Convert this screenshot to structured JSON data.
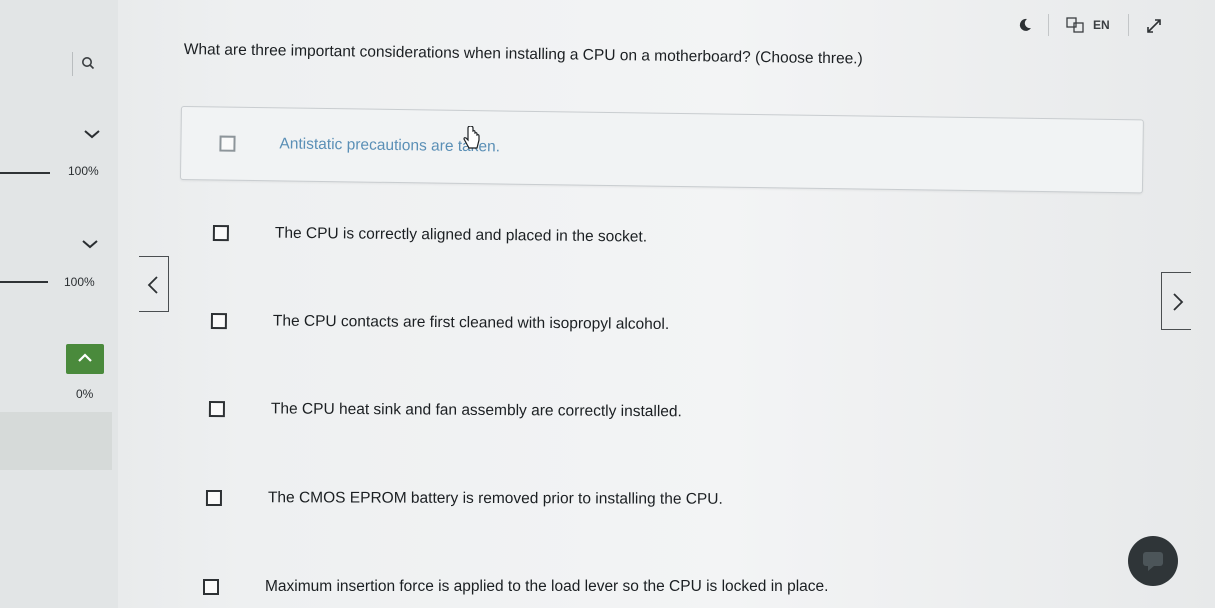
{
  "sidebar": {
    "progress": [
      {
        "label": "100%",
        "value": 1.0,
        "icon": "chevron-down-icon"
      },
      {
        "label": "100%",
        "value": 1.0,
        "icon": "chevron-down-icon"
      },
      {
        "label": "0%",
        "value": 0.0,
        "icon": "chevron-up-icon"
      }
    ],
    "accent_color": "#4a8a3c"
  },
  "topbar": {
    "theme_icon": "moon-icon",
    "language_icon": "translate-icon",
    "language_label": "EN",
    "expand_icon": "expand-icon"
  },
  "question": {
    "text": "What are three important considerations when installing a CPU on a motherboard? (Choose three.)"
  },
  "options": [
    {
      "label": "Antistatic precautions are taken.",
      "checked": false,
      "hovered": true
    },
    {
      "label": "The CPU is correctly aligned and placed in the socket.",
      "checked": false
    },
    {
      "label": "The CPU contacts are first cleaned with isopropyl alcohol.",
      "checked": false
    },
    {
      "label": "The CPU heat sink and fan assembly are correctly installed.",
      "checked": false
    },
    {
      "label": "The CMOS EPROM battery is removed prior to installing the CPU.",
      "checked": false
    },
    {
      "label": "Maximum insertion force is applied to the load lever so the CPU is locked in place.",
      "checked": false
    }
  ],
  "navigation": {
    "prev_icon": "chevron-left-icon",
    "next_icon": "chevron-right-icon"
  },
  "chat_icon": "chat-bubble-icon"
}
